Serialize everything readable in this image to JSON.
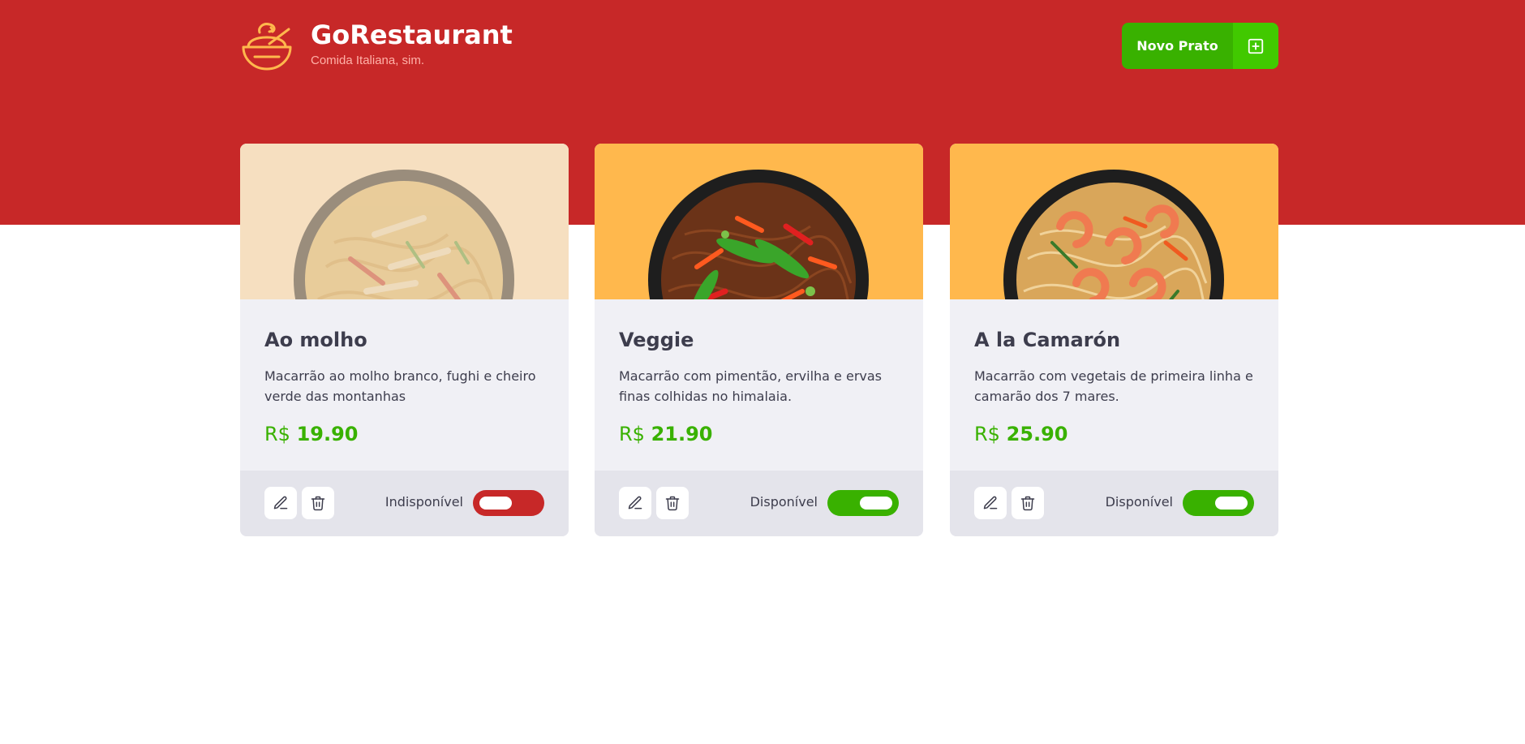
{
  "header": {
    "title": "GoRestaurant",
    "subtitle": "Comida Italiana, sim.",
    "new_button_label": "Novo Prato"
  },
  "colors": {
    "brand_red": "#c72828",
    "accent_green": "#39b100",
    "accent_orange": "#ffb84d"
  },
  "foods": [
    {
      "name": "Ao molho",
      "description": "Macarrão ao molho branco, fughi e cheiro verde das montanhas",
      "currency": "R$",
      "price": "19.90",
      "available": false,
      "availability_label": "Indisponível"
    },
    {
      "name": "Veggie",
      "description": "Macarrão com pimentão, ervilha e ervas finas colhidas no himalaia.",
      "currency": "R$",
      "price": "21.90",
      "available": true,
      "availability_label": "Disponível"
    },
    {
      "name": "A la Camarón",
      "description": "Macarrão com vegetais de primeira linha e camarão dos 7 mares.",
      "currency": "R$",
      "price": "25.90",
      "available": true,
      "availability_label": "Disponível"
    }
  ]
}
